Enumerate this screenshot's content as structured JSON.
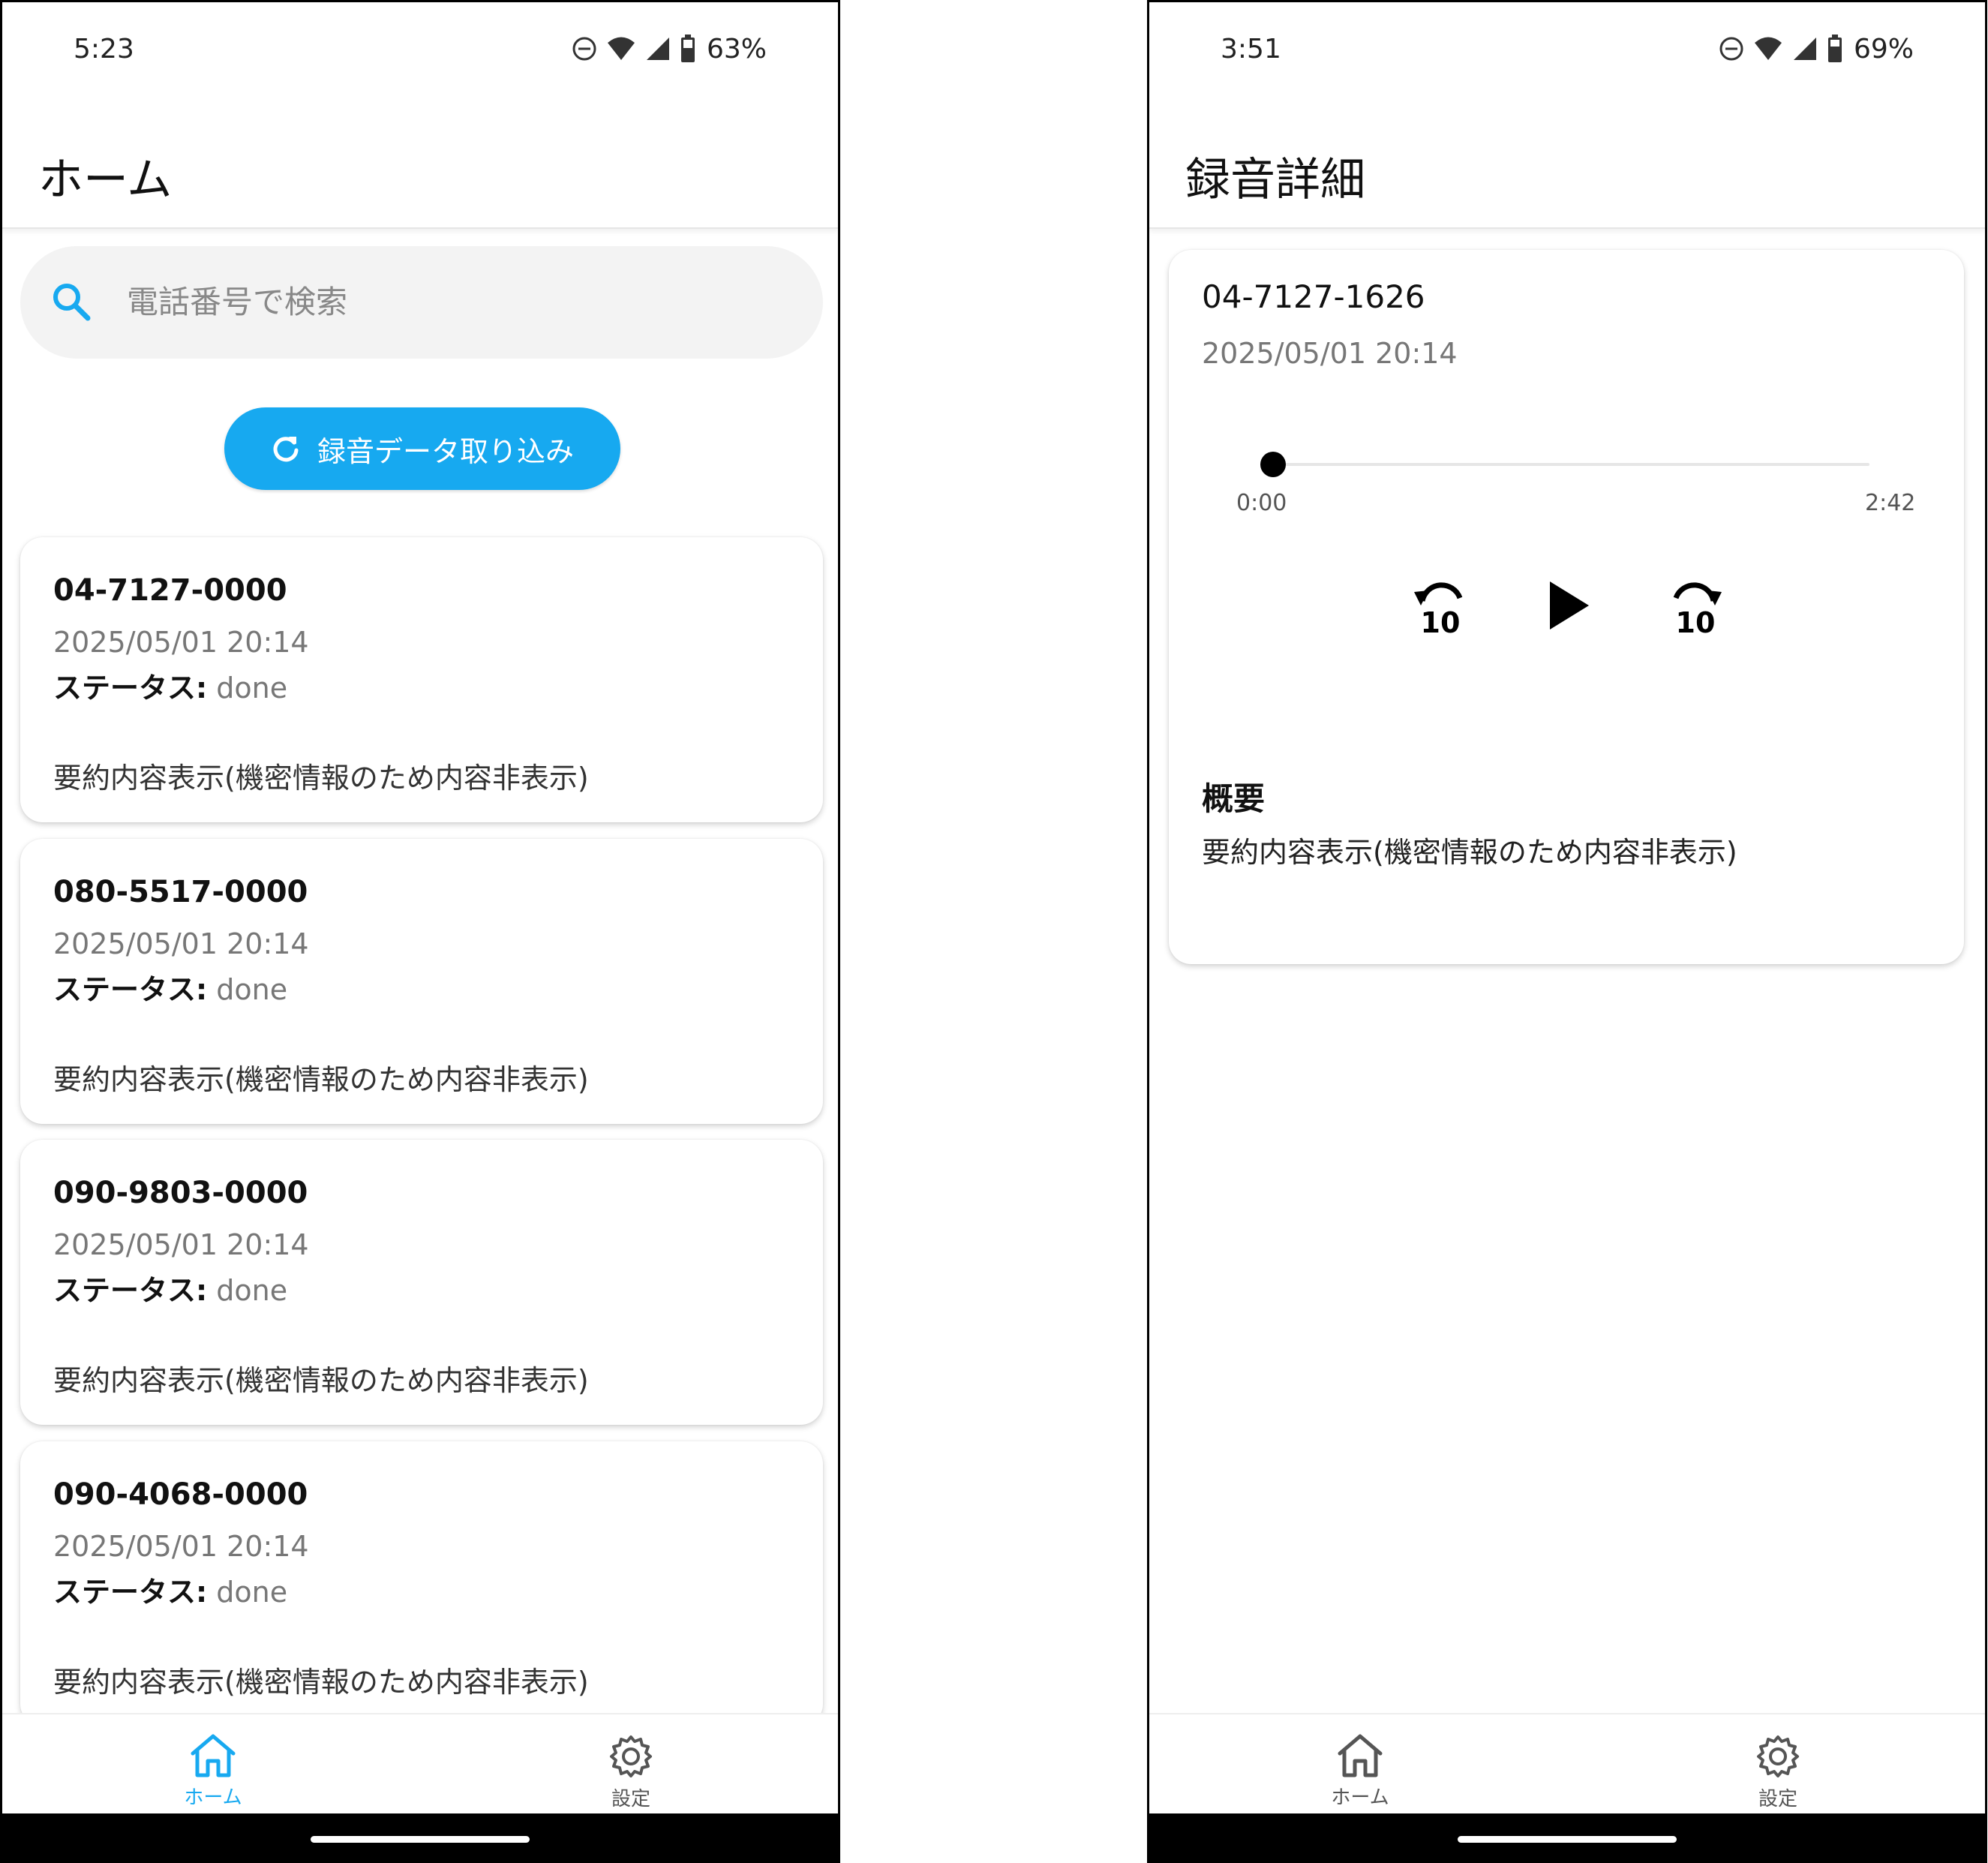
{
  "left_screen": {
    "status_bar": {
      "time": "5:23",
      "battery": "63%"
    },
    "title": "ホーム",
    "search": {
      "placeholder": "電話番号で検索"
    },
    "import_button": {
      "label": "録音データ取り込み"
    },
    "recordings": [
      {
        "phone": "04-7127-0000",
        "date": "2025/05/01 20:14",
        "status_label": "ステータス:",
        "status": "done",
        "summary": "要約内容表示(機密情報のため内容非表示)"
      },
      {
        "phone": "080-5517-0000",
        "date": "2025/05/01 20:14",
        "status_label": "ステータス:",
        "status": "done",
        "summary": "要約内容表示(機密情報のため内容非表示)"
      },
      {
        "phone": "090-9803-0000",
        "date": "2025/05/01 20:14",
        "status_label": "ステータス:",
        "status": "done",
        "summary": "要約内容表示(機密情報のため内容非表示)"
      },
      {
        "phone": "090-4068-0000",
        "date": "2025/05/01 20:14",
        "status_label": "ステータス:",
        "status": "done",
        "summary": "要約内容表示(機密情報のため内容非表示)"
      }
    ],
    "nav": {
      "home_label": "ホーム",
      "settings_label": "設定",
      "active": "home"
    }
  },
  "right_screen": {
    "status_bar": {
      "time": "3:51",
      "battery": "69%"
    },
    "title": "録音詳細",
    "detail": {
      "phone": "04-7127-1626",
      "date": "2025/05/01 20:14",
      "player": {
        "current_time": "0:00",
        "duration": "2:42",
        "progress": 0,
        "controls": [
          "rewind-10-icon",
          "play-icon",
          "forward-10-icon"
        ]
      },
      "summary_heading": "概要",
      "summary_text": "要約内容表示(機密情報のため内容非表示)"
    },
    "nav": {
      "home_label": "ホーム",
      "settings_label": "設定",
      "active": "none"
    }
  },
  "colors": {
    "accent": "#17a9f0",
    "card_bg": "#ffffff",
    "search_bg": "#f3f3f3",
    "muted_text": "#777777"
  }
}
